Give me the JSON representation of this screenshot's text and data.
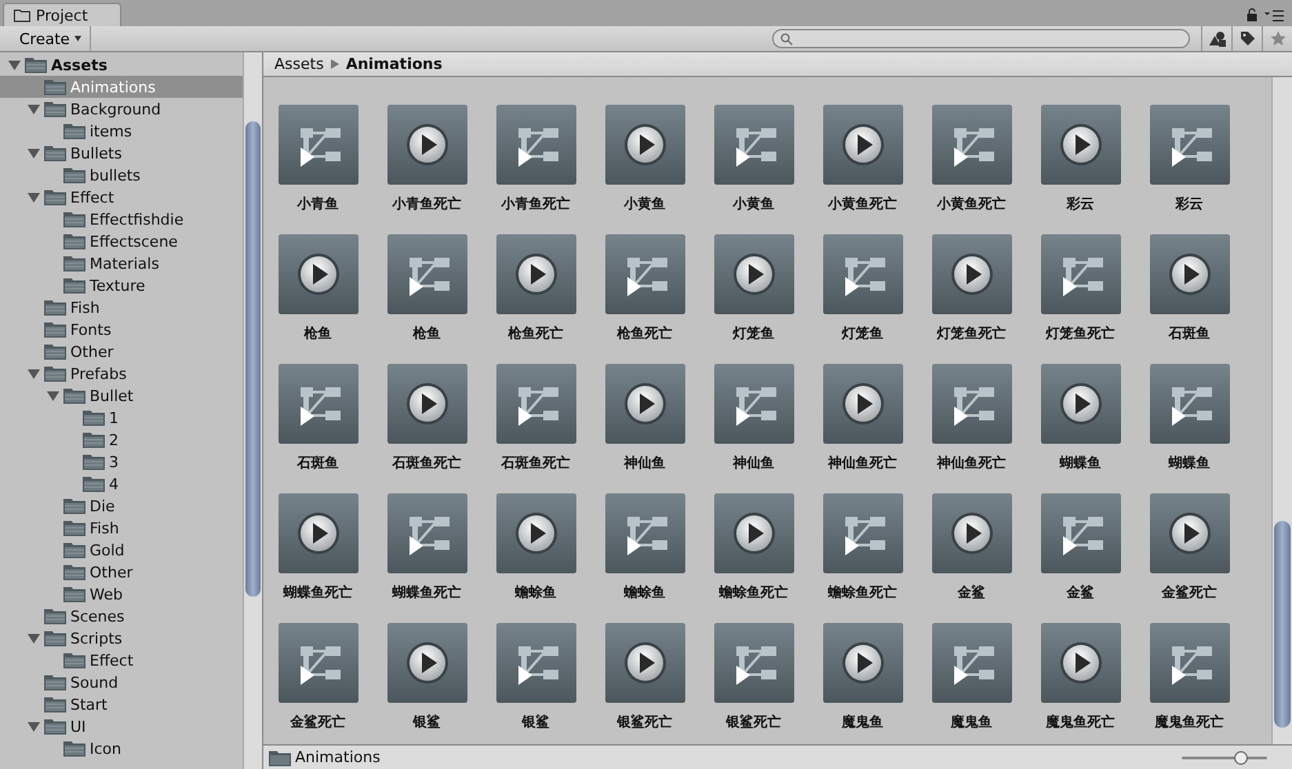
{
  "tab": {
    "title": "Project"
  },
  "toolbar": {
    "create_label": "Create"
  },
  "tree": [
    {
      "label": "Assets",
      "selected": false,
      "expanded": true,
      "children": [
        {
          "label": "Animations",
          "selected": true
        },
        {
          "label": "Background",
          "selected": false,
          "expanded": true,
          "children": [
            {
              "label": "items",
              "selected": false
            }
          ]
        },
        {
          "label": "Bullets",
          "selected": false,
          "expanded": true,
          "children": [
            {
              "label": "bullets",
              "selected": false
            }
          ]
        },
        {
          "label": "Effect",
          "selected": false,
          "expanded": true,
          "children": [
            {
              "label": "Effectfishdie",
              "selected": false
            },
            {
              "label": "Effectscene",
              "selected": false
            },
            {
              "label": "Materials",
              "selected": false
            },
            {
              "label": "Texture",
              "selected": false
            }
          ]
        },
        {
          "label": "Fish",
          "selected": false
        },
        {
          "label": "Fonts",
          "selected": false
        },
        {
          "label": "Other",
          "selected": false
        },
        {
          "label": "Prefabs",
          "selected": false,
          "expanded": true,
          "children": [
            {
              "label": "Bullet",
              "selected": false,
              "expanded": true,
              "children": [
                {
                  "label": "1",
                  "selected": false
                },
                {
                  "label": "2",
                  "selected": false
                },
                {
                  "label": "3",
                  "selected": false
                },
                {
                  "label": "4",
                  "selected": false
                }
              ]
            },
            {
              "label": "Die",
              "selected": false
            },
            {
              "label": "Fish",
              "selected": false
            },
            {
              "label": "Gold",
              "selected": false
            },
            {
              "label": "Other",
              "selected": false
            },
            {
              "label": "Web",
              "selected": false
            }
          ]
        },
        {
          "label": "Scenes",
          "selected": false
        },
        {
          "label": "Scripts",
          "selected": false,
          "expanded": true,
          "children": [
            {
              "label": "Effect",
              "selected": false
            }
          ]
        },
        {
          "label": "Sound",
          "selected": false
        },
        {
          "label": "Start",
          "selected": false
        },
        {
          "label": "UI",
          "selected": false,
          "expanded": true,
          "children": [
            {
              "label": "Icon",
              "selected": false
            }
          ]
        }
      ]
    }
  ],
  "breadcrumb": [
    "Assets",
    "Animations"
  ],
  "assets": [
    {
      "kind": "controller",
      "label": "小青鱼"
    },
    {
      "kind": "clip",
      "label": "小青鱼死亡"
    },
    {
      "kind": "controller",
      "label": "小青鱼死亡"
    },
    {
      "kind": "clip",
      "label": "小黄鱼"
    },
    {
      "kind": "controller",
      "label": "小黄鱼"
    },
    {
      "kind": "clip",
      "label": "小黄鱼死亡"
    },
    {
      "kind": "controller",
      "label": "小黄鱼死亡"
    },
    {
      "kind": "clip",
      "label": "彩云"
    },
    {
      "kind": "controller",
      "label": "彩云"
    },
    {
      "kind": "clip",
      "label": "枪鱼"
    },
    {
      "kind": "controller",
      "label": "枪鱼"
    },
    {
      "kind": "clip",
      "label": "枪鱼死亡"
    },
    {
      "kind": "controller",
      "label": "枪鱼死亡"
    },
    {
      "kind": "clip",
      "label": "灯笼鱼"
    },
    {
      "kind": "controller",
      "label": "灯笼鱼"
    },
    {
      "kind": "clip",
      "label": "灯笼鱼死亡"
    },
    {
      "kind": "controller",
      "label": "灯笼鱼死亡"
    },
    {
      "kind": "clip",
      "label": "石斑鱼"
    },
    {
      "kind": "controller",
      "label": "石斑鱼"
    },
    {
      "kind": "clip",
      "label": "石斑鱼死亡"
    },
    {
      "kind": "controller",
      "label": "石斑鱼死亡"
    },
    {
      "kind": "clip",
      "label": "神仙鱼"
    },
    {
      "kind": "controller",
      "label": "神仙鱼"
    },
    {
      "kind": "clip",
      "label": "神仙鱼死亡"
    },
    {
      "kind": "controller",
      "label": "神仙鱼死亡"
    },
    {
      "kind": "clip",
      "label": "蝴蝶鱼"
    },
    {
      "kind": "controller",
      "label": "蝴蝶鱼"
    },
    {
      "kind": "clip",
      "label": "蝴蝶鱼死亡"
    },
    {
      "kind": "controller",
      "label": "蝴蝶鱼死亡"
    },
    {
      "kind": "clip",
      "label": "蟾蜍鱼"
    },
    {
      "kind": "controller",
      "label": "蟾蜍鱼"
    },
    {
      "kind": "clip",
      "label": "蟾蜍鱼死亡"
    },
    {
      "kind": "controller",
      "label": "蟾蜍鱼死亡"
    },
    {
      "kind": "clip",
      "label": "金鲨"
    },
    {
      "kind": "controller",
      "label": "金鲨"
    },
    {
      "kind": "clip",
      "label": "金鲨死亡"
    },
    {
      "kind": "controller",
      "label": "金鲨死亡"
    },
    {
      "kind": "clip",
      "label": "银鲨"
    },
    {
      "kind": "controller",
      "label": "银鲨"
    },
    {
      "kind": "clip",
      "label": "银鲨死亡"
    },
    {
      "kind": "controller",
      "label": "银鲨死亡"
    },
    {
      "kind": "clip",
      "label": "魔鬼鱼"
    },
    {
      "kind": "controller",
      "label": "魔鬼鱼"
    },
    {
      "kind": "clip",
      "label": "魔鬼鱼死亡"
    },
    {
      "kind": "controller",
      "label": "魔鬼鱼死亡"
    }
  ],
  "status_bar": {
    "path": "Animations",
    "zoom": {
      "level": 0.7
    }
  }
}
